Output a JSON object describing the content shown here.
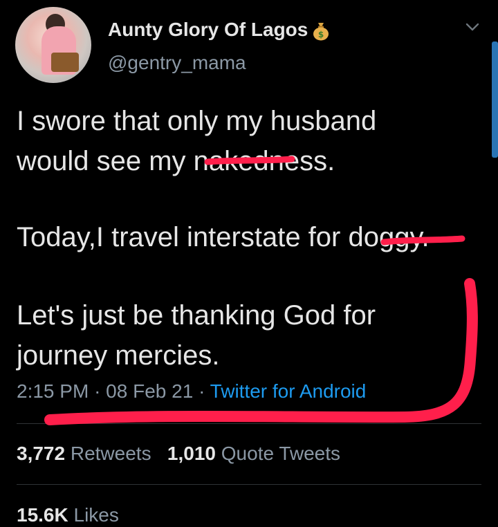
{
  "author": {
    "display_name": "Aunty Glory Of Lagos",
    "handle": "@gentry_mama",
    "name_emoji": "money-bag-icon"
  },
  "tweet": {
    "line1": "I swore that only my husband",
    "line2": "would see my nakedness.",
    "line3": "Today,I travel interstate for doggy.",
    "line4": "Let's just be thanking God for",
    "line5": "journey mercies."
  },
  "meta": {
    "time": "2:15 PM",
    "date": "08 Feb 21",
    "separator": "·",
    "source": "Twitter for Android"
  },
  "stats": {
    "retweets_count": "3,772",
    "retweets_label": "Retweets",
    "quotes_count": "1,010",
    "quotes_label": "Quote Tweets",
    "likes_count": "15.6K",
    "likes_label": "Likes"
  },
  "colors": {
    "background": "#000000",
    "text": "#e6e6e6",
    "secondary": "#8b98a5",
    "link": "#1d9bf0",
    "annotation": "#ff1f4b"
  }
}
